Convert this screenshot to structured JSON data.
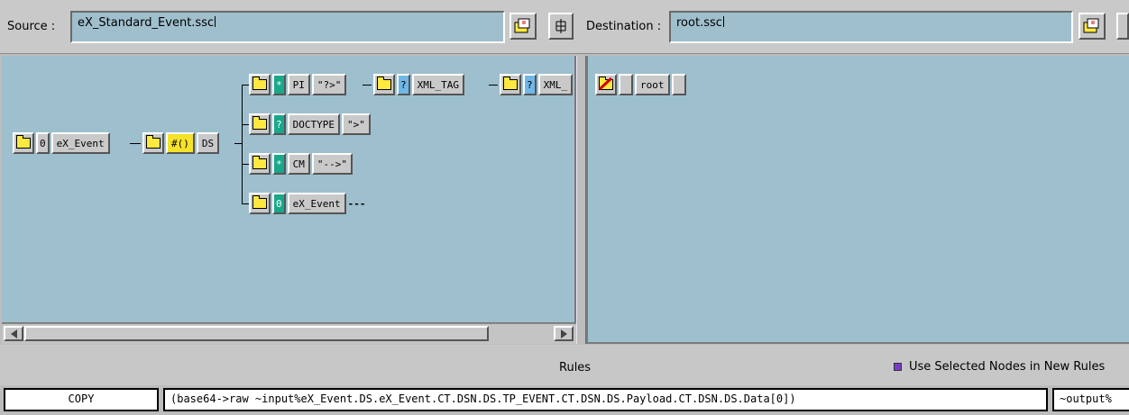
{
  "source": {
    "label": "Source :",
    "file": "eX_Standard_Event.ssc"
  },
  "destination": {
    "label": "Destination :",
    "file": "root.ssc"
  },
  "icons": {
    "open": "open-file-icon",
    "layout": "tree-layout-icon"
  },
  "tree": {
    "root": {
      "count": "0",
      "name": "eX_Event"
    },
    "ds": {
      "repeat": "#()",
      "name": "DS"
    },
    "branches": [
      {
        "mark": "*",
        "name": "PI",
        "delim": "\"?>\""
      },
      {
        "mark": "?",
        "name": "DOCTYPE",
        "delim": "\">\""
      },
      {
        "mark": "*",
        "name": "CM",
        "delim": "\"-->\""
      },
      {
        "mark": "0",
        "name": "eX_Event",
        "delim": "---"
      }
    ],
    "pi_children": [
      {
        "mark": "?",
        "name": "XML_TAG"
      },
      {
        "mark": "?",
        "name": "XML_"
      }
    ]
  },
  "dest_tree": {
    "name": "root"
  },
  "rules": {
    "title": "Rules",
    "use_selected": "Use Selected Nodes in New Rules",
    "row": {
      "op": "COPY",
      "expr": "(base64->raw ~input%eX_Event.DS.eX_Event.CT.DSN.DS.TP_EVENT.CT.DSN.DS.Payload.CT.DSN.DS.Data[0])",
      "out": "~output%"
    }
  }
}
